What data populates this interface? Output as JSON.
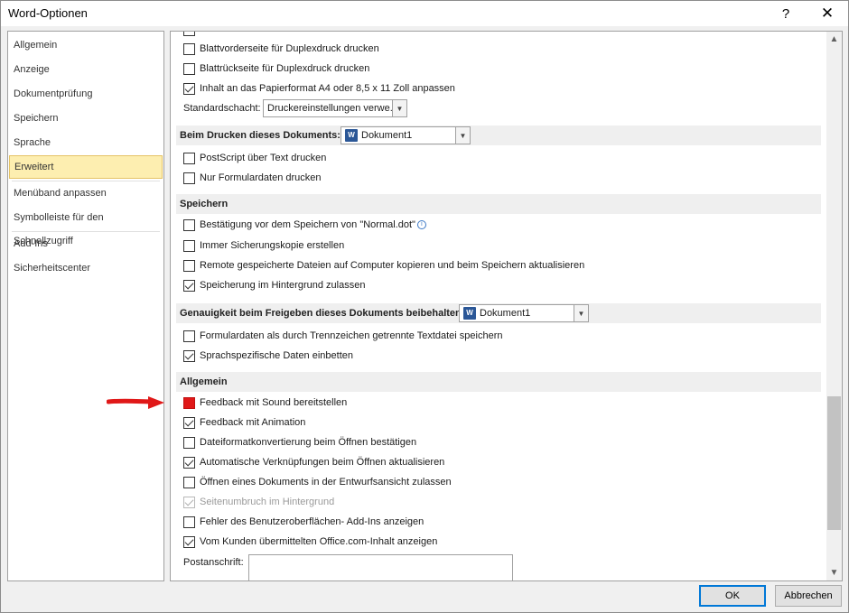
{
  "window": {
    "title": "Word-Optionen",
    "help_glyph": "?",
    "close_glyph": "✕"
  },
  "nav": {
    "items": [
      {
        "label": "Allgemein",
        "selected": false
      },
      {
        "label": "Anzeige",
        "selected": false
      },
      {
        "label": "Dokumentprüfung",
        "selected": false
      },
      {
        "label": "Speichern",
        "selected": false
      },
      {
        "label": "Sprache",
        "selected": false
      },
      {
        "label": "Erweitert",
        "selected": true
      },
      {
        "label": "Menüband anpassen",
        "selected": false
      },
      {
        "label": "Symbolleiste für den Schnellzugriff",
        "selected": false
      },
      {
        "label": "Add-Ins",
        "selected": false
      },
      {
        "label": "Sicherheitscenter",
        "selected": false
      }
    ]
  },
  "print_options": [
    {
      "label": "Blattvorderseite für Duplexdruck drucken",
      "checked": false
    },
    {
      "label": "Blattrückseite für Duplexdruck drucken",
      "checked": false
    },
    {
      "label": "Inhalt an das Papierformat A4 oder 8,5 x 11 Zoll anpassen",
      "checked": true
    }
  ],
  "standard_tray": {
    "label": "Standardschacht:",
    "value": "Druckereinstellungen verwe..."
  },
  "print_doc_section": {
    "title": "Beim Drucken dieses Dokuments:",
    "document": "Dokument1"
  },
  "print_doc_options": [
    {
      "label": "PostScript über Text drucken",
      "checked": false
    },
    {
      "label": "Nur Formulardaten drucken",
      "checked": false
    }
  ],
  "save_section": {
    "title": "Speichern"
  },
  "save_options": [
    {
      "label": "Bestätigung vor dem Speichern von \"Normal.dot\"",
      "checked": false,
      "info": true
    },
    {
      "label": "Immer Sicherungskopie erstellen",
      "checked": false
    },
    {
      "label": "Remote gespeicherte Dateien auf Computer kopieren und beim Speichern aktualisieren",
      "checked": false
    },
    {
      "label": "Speicherung im Hintergrund zulassen",
      "checked": true
    }
  ],
  "fidelity_section": {
    "title": "Genauigkeit beim Freigeben dieses Dokuments beibehalten:",
    "document": "Dokument1"
  },
  "fidelity_options": [
    {
      "label": "Formulardaten als durch Trennzeichen getrennte Textdatei speichern",
      "checked": false
    },
    {
      "label": "Sprachspezifische Daten einbetten",
      "checked": true
    }
  ],
  "general_section": {
    "title": "Allgemein"
  },
  "general_options": [
    {
      "label": "Feedback mit Sound bereitstellen",
      "checked": false,
      "highlight": true
    },
    {
      "label": "Feedback mit Animation",
      "checked": true
    },
    {
      "label": "Dateiformatkonvertierung beim Öffnen bestätigen",
      "checked": false
    },
    {
      "label": "Automatische Verknüpfungen beim Öffnen aktualisieren",
      "checked": true
    },
    {
      "label": "Öffnen eines Dokuments in der Entwurfsansicht zulassen",
      "checked": false
    },
    {
      "label": "Seitenumbruch im Hintergrund",
      "checked": true,
      "disabled": true
    },
    {
      "label": "Fehler des Benutzeroberflächen- Add-Ins anzeigen",
      "checked": false
    },
    {
      "label": "Vom Kunden übermittelten Office.com-Inhalt anzeigen",
      "checked": true
    }
  ],
  "postal_address": {
    "label": "Postanschrift:"
  },
  "buttons": {
    "ok": "OK",
    "cancel": "Abbrechen"
  },
  "colors": {
    "selected_bg": "#fdeeb0",
    "annotation": "#e01818",
    "accent": "#0078d7"
  }
}
